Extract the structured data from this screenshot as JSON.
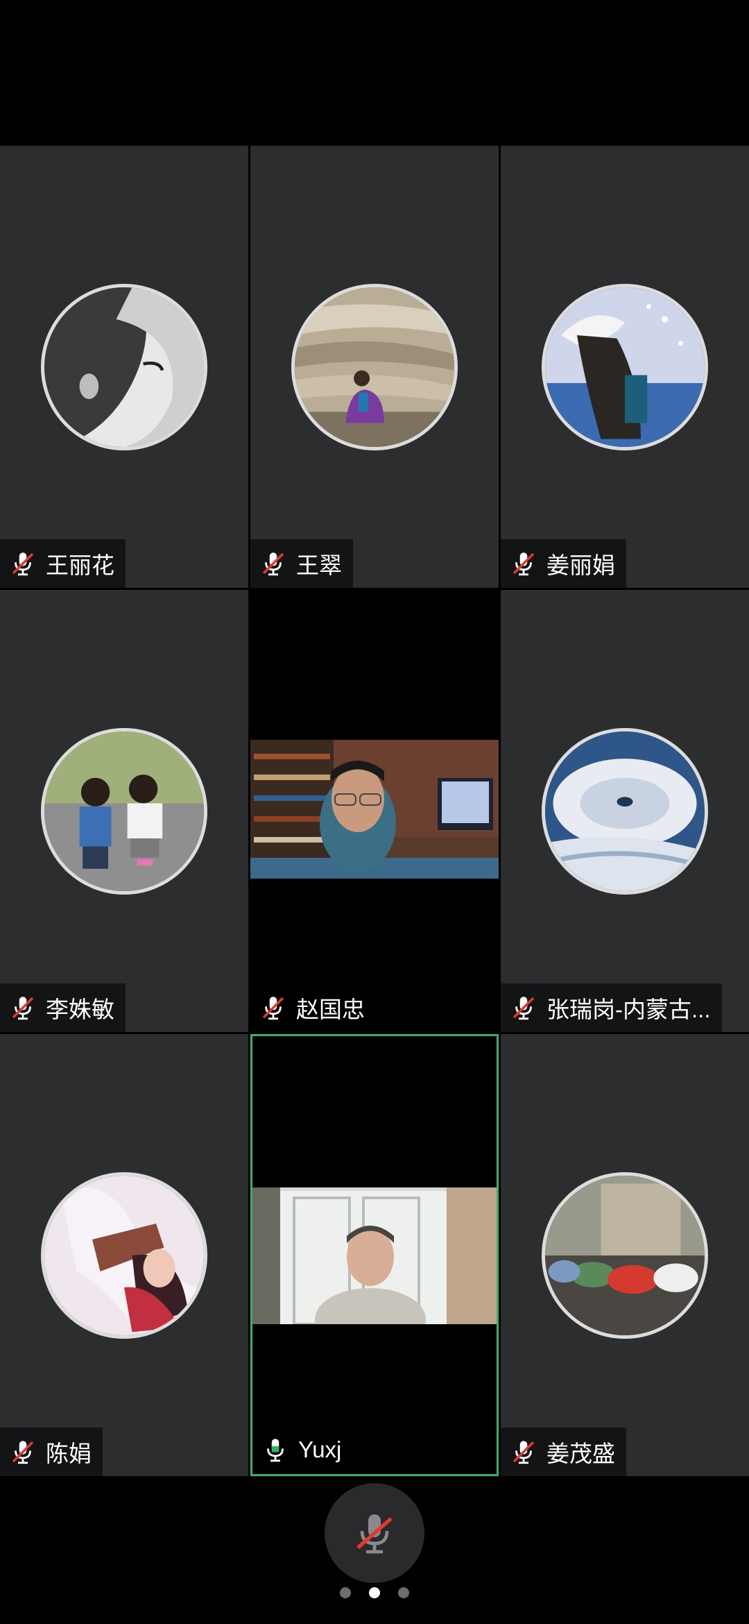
{
  "participants": [
    {
      "name": "王丽花",
      "muted": true
    },
    {
      "name": "王翠",
      "muted": true
    },
    {
      "name": "姜丽娟",
      "muted": true
    },
    {
      "name": "李姝敏",
      "muted": true
    },
    {
      "name": "赵国忠",
      "muted": true
    },
    {
      "name": "张瑞岗-内蒙古...",
      "muted": true
    },
    {
      "name": "陈娟",
      "muted": true
    },
    {
      "name": "Yuxj",
      "muted": false
    },
    {
      "name": "姜茂盛",
      "muted": true
    }
  ],
  "controls": {
    "mic_state": "muted",
    "page_count": 3,
    "current_page": 2
  },
  "colors": {
    "tile_bg": "#2c2d2f",
    "active_speaker_border": "#2fb36a",
    "muted_red": "#e5372c",
    "mic_on_green": "#2fb36a"
  }
}
